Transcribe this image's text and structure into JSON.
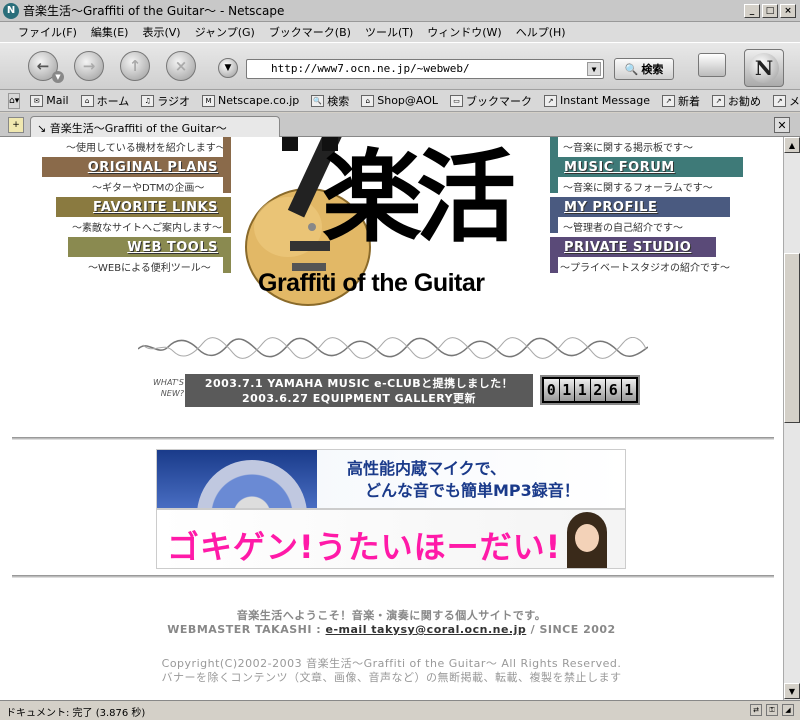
{
  "window": {
    "title": "音楽生活～Graffiti of the Guitar～ - Netscape",
    "app_icon": "netscape-icon",
    "buttons": [
      "_",
      "□",
      "×"
    ]
  },
  "menu": [
    "ファイル(F)",
    "編集(E)",
    "表示(V)",
    "ジャンプ(G)",
    "ブックマーク(B)",
    "ツール(T)",
    "ウィンドウ(W)",
    "ヘルプ(H)"
  ],
  "nav": {
    "url": "http://www7.ocn.ne.jp/~webweb/",
    "search_label": "検索"
  },
  "personal_toolbar": [
    {
      "label": "Mail",
      "icon": "mail-icon"
    },
    {
      "label": "ホーム",
      "icon": "home-icon"
    },
    {
      "label": "ラジオ",
      "icon": "radio-icon"
    },
    {
      "label": "Netscape.co.jp",
      "icon": "netscape-link-icon"
    },
    {
      "label": "検索",
      "icon": "search-icon"
    },
    {
      "label": "Shop@AOL",
      "icon": "shop-icon"
    },
    {
      "label": "ブックマーク",
      "icon": "folder-icon"
    },
    {
      "label": "Instant Message",
      "icon": "link-icon"
    },
    {
      "label": "新着",
      "icon": "link-icon"
    },
    {
      "label": "お勧め",
      "icon": "link-icon"
    },
    {
      "label": "メ",
      "icon": "link-icon"
    }
  ],
  "tab": {
    "title": "音楽生活～Graffiti of the Guitar～"
  },
  "page": {
    "left_nav": {
      "top_caption": "～使用している機材を紹介します～",
      "items": [
        {
          "label": "ORIGINAL PLANS",
          "caption": "～ギターやDTMの企画～",
          "color": "#8a6a4a"
        },
        {
          "label": "FAVORITE LINKS",
          "caption": "～素敵なサイトへご案内します～",
          "color": "#8a7a40"
        },
        {
          "label": "WEB TOOLS",
          "caption": "～WEBによる便利ツール～",
          "color": "#8a8a50"
        }
      ]
    },
    "right_nav": {
      "top_caption": "～音楽に関する掲示板です～",
      "items": [
        {
          "label": "MUSIC FORUM",
          "caption": "～音楽に関するフォーラムです～",
          "color": "#3e7a78"
        },
        {
          "label": "MY PROFILE",
          "caption": "～管理者の自己紹介です～",
          "color": "#4a5a80"
        },
        {
          "label": "PRIVATE STUDIO",
          "caption": "～プライベートスタジオの紹介です～",
          "color": "#5a4a78"
        }
      ]
    },
    "logo": {
      "kanji": "楽活",
      "subtitle": "Graffiti of the Guitar"
    },
    "whats_new_label": "WHAT'S NEW?",
    "news": [
      "2003.7.1 YAMAHA MUSIC e-CLUBと提携しました！",
      "2003.6.27 EQUIPMENT GALLERY更新"
    ],
    "counter": [
      "0",
      "1",
      "1",
      "2",
      "6",
      "1"
    ],
    "banner1_lines": [
      "高性能内蔵マイクで、",
      "どんな音でも簡単MP3録音！"
    ],
    "banner2_text": "ゴキゲン!うたいほーだい!",
    "footer": {
      "intro": "音楽生活へようこそ！音楽・演奏に関する個人サイトです。",
      "webmaster_prefix": "WEBMASTER TAKASHI :",
      "email_link": "e-mail takysy@coral.ocn.ne.jp",
      "since": "/ SINCE 2002",
      "copyright": "Copyright(C)2002-2003 音楽生活～Graffiti of the Guitar～ All Rights Reserved.",
      "notice": "バナーを除くコンテンツ（文章、画像、音声など）の無断掲載、転載、複製を禁止します"
    }
  },
  "status": {
    "text": "ドキュメント: 完了 (3.876 秒)"
  }
}
